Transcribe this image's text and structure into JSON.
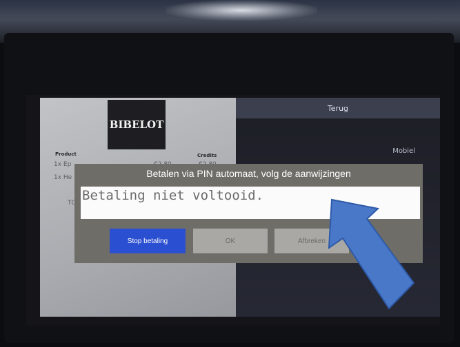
{
  "brand": {
    "logo_text": "BIBELOT"
  },
  "left_panel": {
    "product_header": "Product",
    "credits_header": "Credits",
    "line1": "1x Ep",
    "line2": "1x He",
    "price1": "€2.80",
    "price2": "€2.80",
    "total_label": "TO"
  },
  "right_panel": {
    "back_label": "Terug",
    "mobile_label": "Mobiel"
  },
  "dialog": {
    "title": "Betalen via PIN automaat, volg de aanwijzingen",
    "message": "Betaling niet voltooid.",
    "buttons": {
      "stop": "Stop betaling",
      "ok": "OK",
      "cancel": "Afbreken"
    }
  },
  "colors": {
    "dialog_bg": "#6f6d68",
    "stop_button": "#2b4fd1",
    "arrow": "#4a78c8"
  },
  "icons": [
    "pointer-arrow"
  ]
}
